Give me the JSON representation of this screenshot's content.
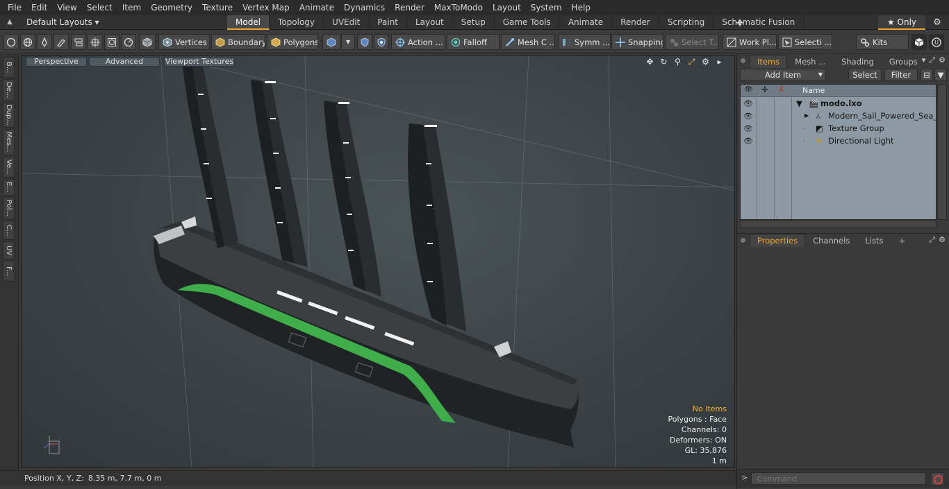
{
  "menu": [
    "File",
    "Edit",
    "View",
    "Select",
    "Item",
    "Geometry",
    "Texture",
    "Vertex Map",
    "Animate",
    "Dynamics",
    "Render",
    "MaxToModo",
    "Layout",
    "System",
    "Help"
  ],
  "layouts_label": "Default Layouts ▾",
  "layout_tabs": [
    {
      "label": "Model",
      "active": true
    },
    {
      "label": "Topology"
    },
    {
      "label": "UVEdit"
    },
    {
      "label": "Paint"
    },
    {
      "label": "Layout"
    },
    {
      "label": "Setup"
    },
    {
      "label": "Game Tools"
    },
    {
      "label": "Animate"
    },
    {
      "label": "Render"
    },
    {
      "label": "Scripting"
    },
    {
      "label": "Schematic Fusion"
    }
  ],
  "only_label": "★  Only",
  "toolbar": {
    "vertices": "Vertices",
    "boundary": "Boundary",
    "polygons": "Polygons",
    "action": "Action ...",
    "falloff": "Falloff",
    "mesh": "Mesh C ...",
    "symm": "Symm ...",
    "snapping": "Snapping",
    "select_t": "Select T...",
    "work_pl": "Work Pl...",
    "selecti": "Selecti ...",
    "kits": "Kits"
  },
  "left_tabs": [
    "B...",
    "De...",
    "Dup...",
    "Mes...",
    "Ve...",
    "E...",
    "Pol...",
    "C...",
    "UV",
    "F..."
  ],
  "viewport": {
    "perspective": "Perspective",
    "advanced": "Advanced",
    "viewport_textures": "Viewport Textures",
    "stats": {
      "items": "No Items",
      "polygons": "Polygons : Face",
      "channels": "Channels: 0",
      "deformers": "Deformers: ON",
      "gl": "GL: 35,876",
      "scale": "1 m"
    }
  },
  "status": {
    "label": "Position X, Y, Z:",
    "value": "8.35 m, 7.7 m, 0 m"
  },
  "items_panel": {
    "tabs": [
      {
        "label": "Items",
        "active": true
      },
      {
        "label": "Mesh ..."
      },
      {
        "label": "Shading"
      },
      {
        "label": "Groups"
      }
    ],
    "add_item": "Add Item",
    "select": "Select",
    "filter": "Filter",
    "name_header": "Name",
    "tree": [
      {
        "label": "modo.lxo",
        "bold": true
      },
      {
        "label": "Modern_Sail_Powered_Sea_V..."
      },
      {
        "label": "Texture Group"
      },
      {
        "label": "Directional Light"
      }
    ]
  },
  "properties_panel": {
    "tabs": [
      {
        "label": "Properties",
        "active": true
      },
      {
        "label": "Channels"
      },
      {
        "label": "Lists"
      }
    ],
    "add": "+"
  },
  "command": {
    "placeholder": "Command"
  },
  "colors": {
    "accent": "#e8a13a",
    "stripe": "#3fae4a",
    "tree_bg": "#8e9aa3"
  }
}
